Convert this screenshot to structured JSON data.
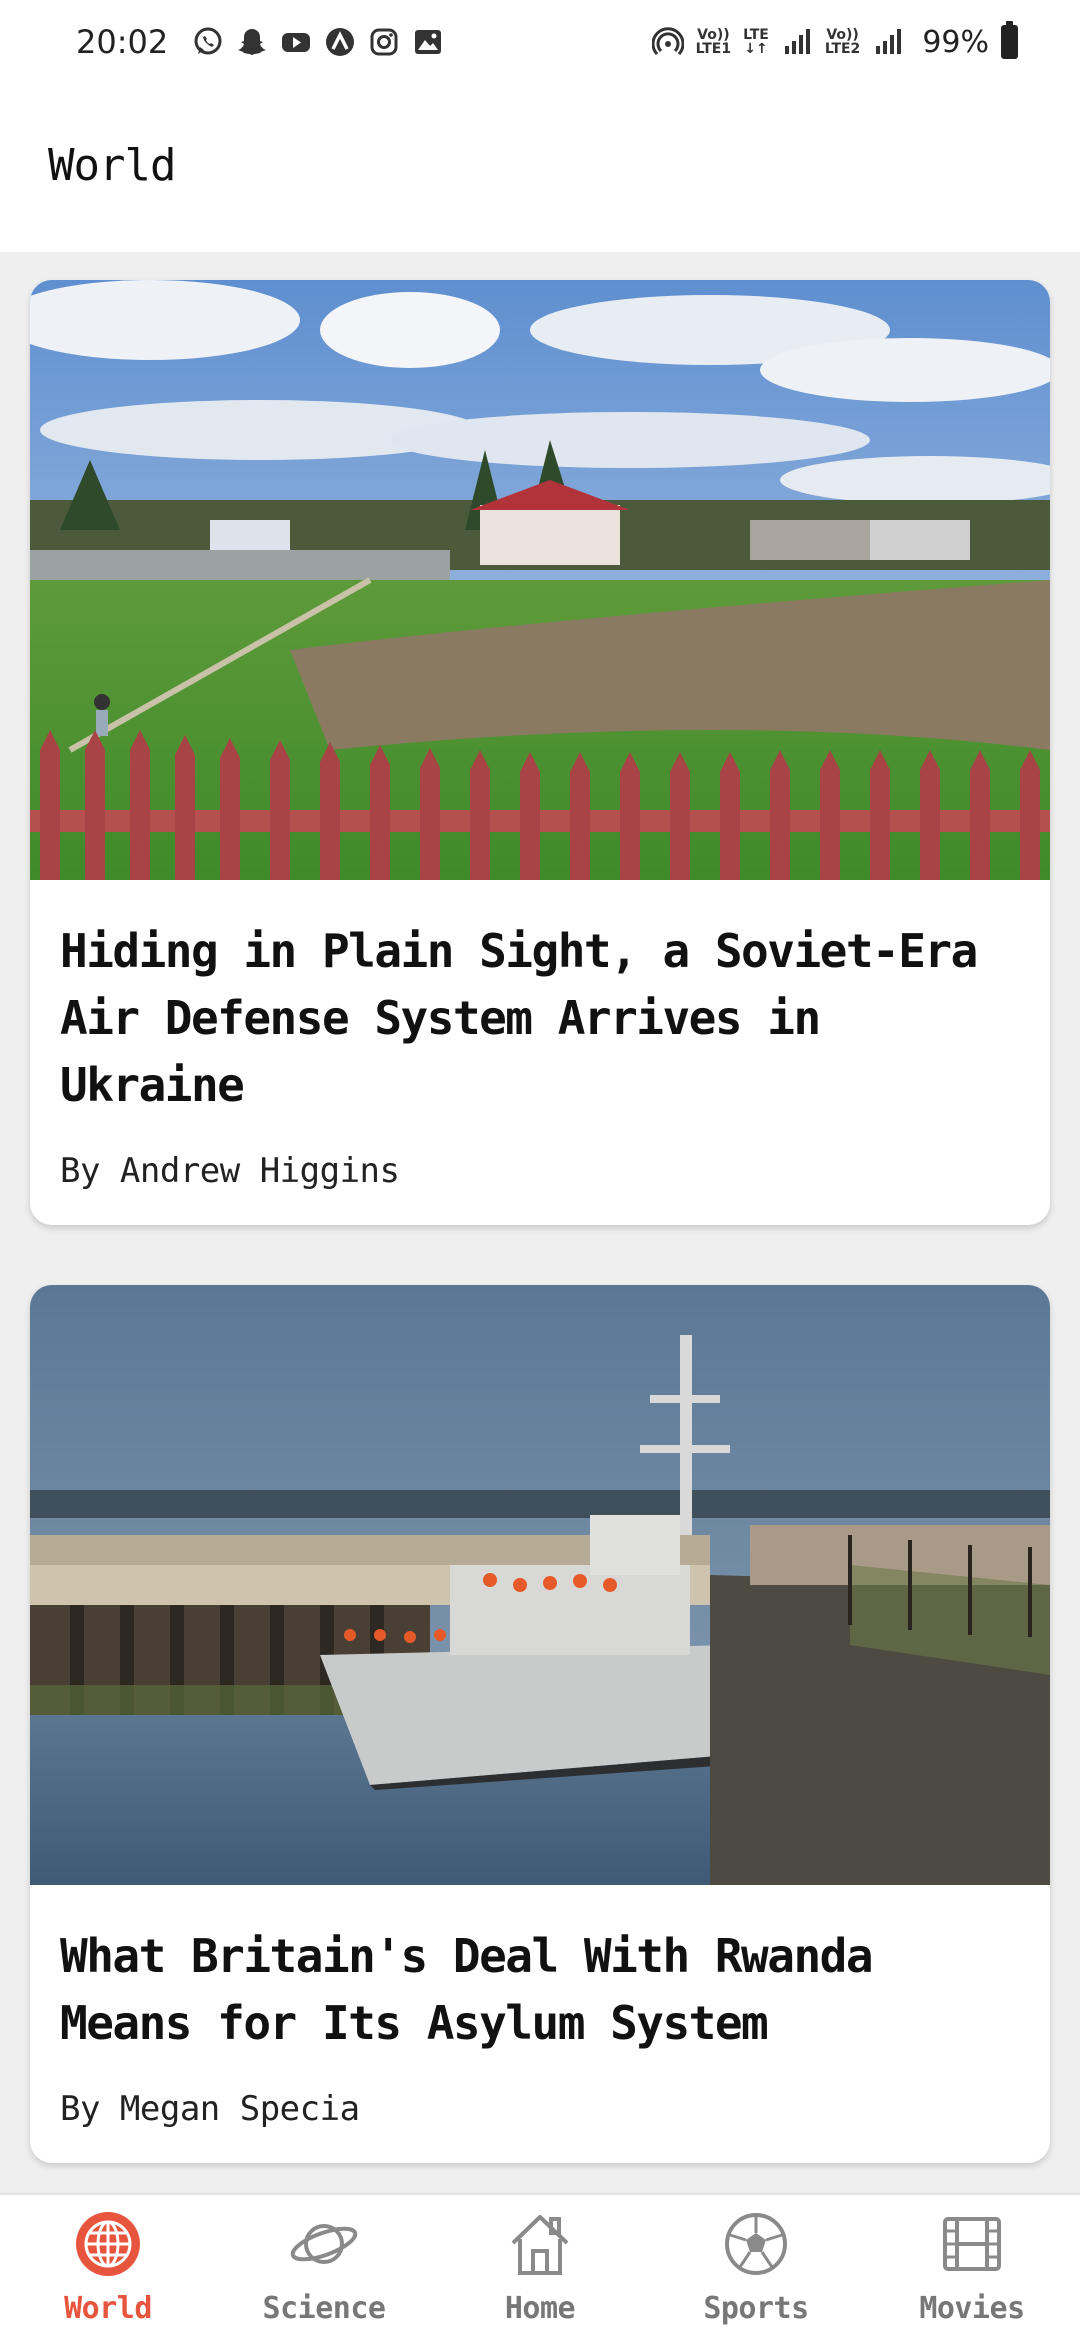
{
  "status_bar": {
    "time": "20:02",
    "left_icons": [
      "whatsapp-icon",
      "snapchat-icon",
      "youtube-icon",
      "arc-icon",
      "instagram-icon",
      "gallery-icon"
    ],
    "hotspot_icon": "hotspot-icon",
    "sim1_label_top": "Vo))",
    "sim1_label_bottom": "LTE1",
    "lte_label_top": "LTE",
    "lte_label_bottom": "↓↑",
    "sim2_label_top": "Vo))",
    "sim2_label_bottom": "LTE2",
    "battery": "99%"
  },
  "header": {
    "title": "World"
  },
  "articles": [
    {
      "headline": "Hiding in Plain Sight, a Soviet-Era Air Defense System Arrives in Ukraine",
      "byline": "By Andrew Higgins",
      "image_subject": "cemetery-field-fence-photo"
    },
    {
      "headline": "What Britain's Deal With Rwanda Means for Its Asylum System",
      "byline": "By Megan Specia",
      "image_subject": "border-force-ship-photo"
    }
  ],
  "nav": {
    "active": "World",
    "active_color": "#e8553f",
    "inactive_color": "#777777",
    "items": [
      {
        "label": "World",
        "icon": "globe-icon"
      },
      {
        "label": "Science",
        "icon": "planet-icon"
      },
      {
        "label": "Home",
        "icon": "house-icon"
      },
      {
        "label": "Sports",
        "icon": "soccer-ball-icon"
      },
      {
        "label": "Movies",
        "icon": "film-icon"
      }
    ]
  }
}
